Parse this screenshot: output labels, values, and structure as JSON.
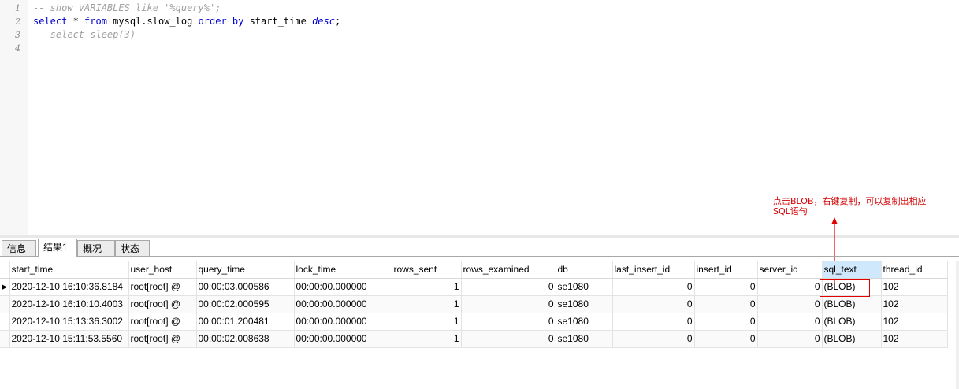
{
  "editor": {
    "line_numbers": [
      "1",
      "2",
      "3",
      "4"
    ],
    "line1": "-- show VARIABLES like '%query%';",
    "line2": {
      "select": "select",
      "star": " * ",
      "from": "from",
      "table": " mysql.slow_log ",
      "order": "order",
      "sp": " ",
      "by": "by",
      "col": " start_time ",
      "desc": "desc",
      "semi": ";"
    },
    "line3": "-- select sleep(3)"
  },
  "annotation": {
    "line1": "点击BLOB，右键复制，可以复制出相应",
    "line2": "SQL语句",
    "color": "#d40000"
  },
  "tabs": [
    "信息",
    "结果1",
    "概况",
    "状态"
  ],
  "active_tab": "结果1",
  "grid": {
    "columns": [
      "start_time",
      "user_host",
      "query_time",
      "lock_time",
      "rows_sent",
      "rows_examined",
      "db",
      "last_insert_id",
      "insert_id",
      "server_id",
      "sql_text",
      "thread_id"
    ],
    "selected_column": "sql_text",
    "current_row_marker": "▶",
    "rows": [
      [
        "2020-12-10 16:10:36.8184",
        "root[root] @",
        "00:00:03.000586",
        "00:00:00.000000",
        "1",
        "0",
        "se1080",
        "0",
        "0",
        "0",
        "(BLOB)",
        "102"
      ],
      [
        "2020-12-10 16:10:10.4003",
        "root[root] @",
        "00:00:02.000595",
        "00:00:00.000000",
        "1",
        "0",
        "se1080",
        "0",
        "0",
        "0",
        "(BLOB)",
        "102"
      ],
      [
        "2020-12-10 15:13:36.3002",
        "root[root] @",
        "00:00:01.200481",
        "00:00:00.000000",
        "1",
        "0",
        "se1080",
        "0",
        "0",
        "0",
        "(BLOB)",
        "102"
      ],
      [
        "2020-12-10 15:11:53.5560",
        "root[root] @",
        "00:00:02.008638",
        "00:00:00.000000",
        "1",
        "0",
        "se1080",
        "0",
        "0",
        "0",
        "(BLOB)",
        "102"
      ]
    ]
  }
}
